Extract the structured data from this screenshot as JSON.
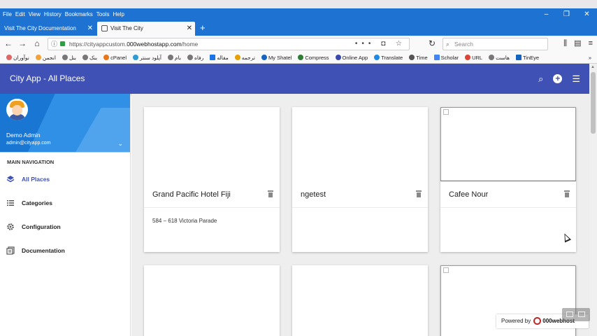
{
  "browser": {
    "menus": [
      "File",
      "Edit",
      "View",
      "History",
      "Bookmarks",
      "Tools",
      "Help"
    ],
    "tabs": [
      {
        "label": "Visit The City Documentation",
        "active": false
      },
      {
        "label": "Visit The City",
        "active": true
      }
    ],
    "url": {
      "prefix": "https://cityappcustom.",
      "host": "000webhostapp.com",
      "path": "/home"
    },
    "search_placeholder": "Search",
    "bookmarks": [
      "نوآوران",
      "انجمن",
      "بنل",
      "بنک",
      "cPanel",
      "آپلود سنتر",
      "بام",
      "رفاه",
      "مقاله",
      "ترجمه",
      "My Shatel",
      "Compress",
      "Online App",
      "Translate",
      "Time",
      "Scholar",
      "URL",
      "هاست",
      "TinEye"
    ]
  },
  "app": {
    "title": "City App - All Places",
    "accent": "#3f51b5"
  },
  "profile": {
    "name": "Demo Admin",
    "email": "admin@cityapp.com"
  },
  "nav": {
    "heading": "MAIN NAVIGATION",
    "items": [
      {
        "label": "All Places",
        "icon": "layers-icon",
        "active": true
      },
      {
        "label": "Categories",
        "icon": "list-icon",
        "active": false
      },
      {
        "label": "Configuration",
        "icon": "gear-icon",
        "active": false
      },
      {
        "label": "Documentation",
        "icon": "document-icon",
        "active": false
      }
    ]
  },
  "places": [
    {
      "title": "Grand Pacific Hotel Fiji",
      "address": "584 – 618 Victoria Parade"
    },
    {
      "title": "ngetest",
      "address": ""
    },
    {
      "title": "Cafee Nour",
      "address": ""
    }
  ],
  "footer": {
    "powered_label": "Powered by",
    "powered_brand": "000webhost"
  }
}
